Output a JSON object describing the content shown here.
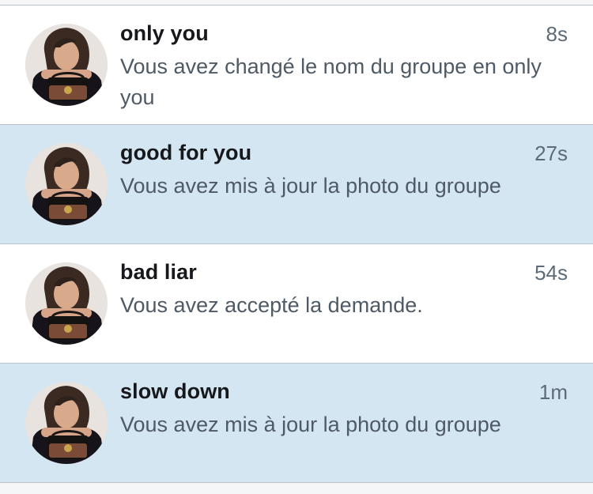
{
  "conversations": [
    {
      "name": "only you",
      "time": "8s",
      "message": "Vous avez changé le nom du groupe en only you",
      "background": "#ffffff"
    },
    {
      "name": "good for you",
      "time": "27s",
      "message": "Vous avez mis à jour la photo du groupe",
      "background": "#d4e6f2"
    },
    {
      "name": "bad liar",
      "time": "54s",
      "message": "Vous avez accepté la demande.",
      "background": "#ffffff"
    },
    {
      "name": "slow down",
      "time": "1m",
      "message": "Vous avez mis à jour la photo du groupe",
      "background": "#d4e6f2"
    }
  ]
}
